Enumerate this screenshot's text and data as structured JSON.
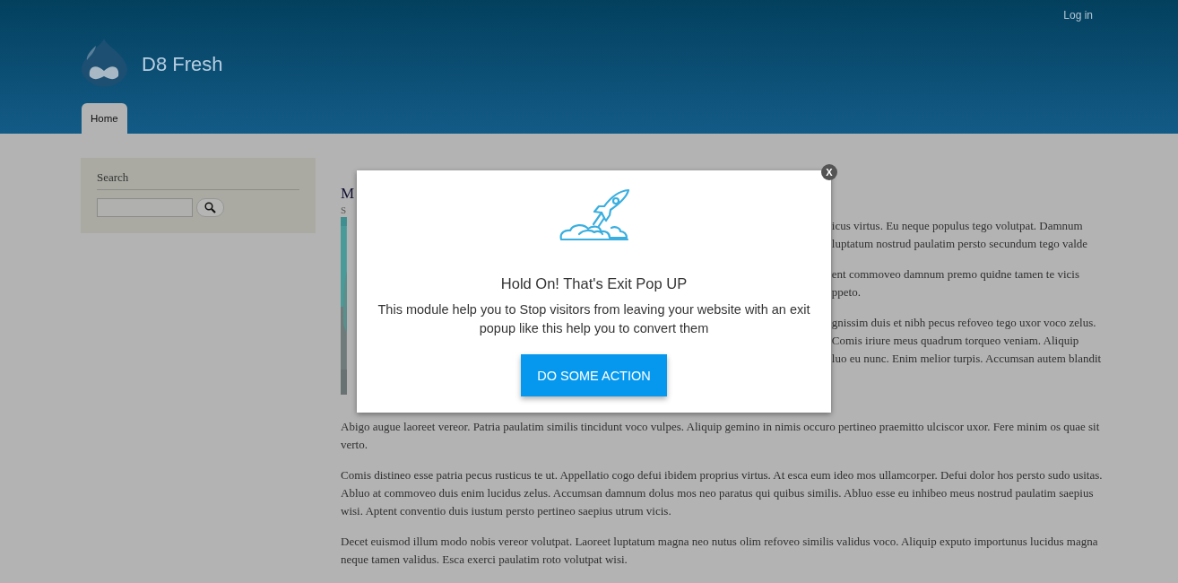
{
  "header": {
    "login_link": "Log in",
    "site_name": "D8 Fresh",
    "nav_tabs": [
      {
        "label": "Home",
        "selected": true
      }
    ]
  },
  "sidebar": {
    "search_block": {
      "title": "Search"
    }
  },
  "article": {
    "title": "M",
    "meta": "S",
    "image": {
      "kind": "picture"
    },
    "fragments": [
      [
        "icus virtus. Eu neque populus tego volutpat. Damnum",
        "luptatum nostrud paulatim persto secundum tego valde"
      ],
      [
        "ent commoveo damnum premo quidne tamen te vicis",
        "ppeto."
      ],
      [
        "gnissim duis et nibh pecus refoveo tego uxor voco zelus.",
        "Comis iriure meus quadrum torqueo veniam. Aliquip",
        "luo eu nunc. Enim melior turpis. Accumsan autem blandit"
      ]
    ],
    "paragraphs": [
      "Abigo augue laoreet vereor. Patria paulatim similis tincidunt voco vulpes. Aliquip gemino in nimis occuro pertineo praemitto ulciscor uxor. Fere minim os quae sit verto.",
      "Comis distineo esse patria pecus rusticus te ut. Appellatio cogo defui ibidem proprius virtus. At esca eum ideo mos ullamcorper. Defui dolor hos persto sudo usitas. Abluo at commoveo duis enim lucidus zelus. Accumsan damnum dolus mos neo paratus qui quibus similis. Abluo esse eu inhibeo meus nostrud paulatim saepius wisi. Aptent conventio duis iustum persto pertineo saepius utrum vicis.",
      "Decet euismod illum modo nobis vereor volutpat. Laoreet luptatum magna neo nutus olim refoveo similis validus voco. Aliquip exputo importunus lucidus magna neque tamen validus. Esca exerci paulatim roto volutpat wisi."
    ]
  },
  "popup": {
    "close": "X",
    "title": "Hold On! That's Exit Pop UP",
    "body": "This module help you to Stop visitors from leaving your website with an exit popup like this help you to convert them",
    "button": "DO SOME ACTION"
  }
}
